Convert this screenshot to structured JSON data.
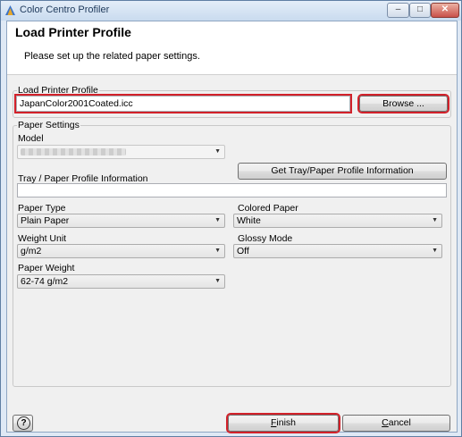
{
  "window": {
    "title": "Color Centro Profiler",
    "minimize_glyph": "–",
    "maximize_glyph": "□",
    "close_glyph": "✕"
  },
  "header": {
    "title": "Load Printer Profile",
    "subtitle": "Please set up the related paper settings."
  },
  "load_printer_profile": {
    "group_label": "Load Printer Profile",
    "file_value": "JapanColor2001Coated.icc",
    "browse_label": "Browse ..."
  },
  "paper_settings": {
    "group_label": "Paper Settings",
    "model_label": "Model",
    "model_value": "",
    "get_info_button": "Get Tray/Paper Profile Information",
    "tray_info_label": "Tray / Paper Profile Information",
    "tray_info_value": "",
    "paper_type_label": "Paper Type",
    "paper_type_value": "Plain Paper",
    "colored_paper_label": "Colored Paper",
    "colored_paper_value": "White",
    "weight_unit_label": "Weight Unit",
    "weight_unit_value": "g/m2",
    "glossy_mode_label": "Glossy Mode",
    "glossy_mode_value": "Off",
    "paper_weight_label": "Paper Weight",
    "paper_weight_value": "62-74 g/m2"
  },
  "footer": {
    "help_glyph": "?",
    "finish_mnemonic": "F",
    "finish_rest": "inish",
    "cancel_mnemonic": "C",
    "cancel_rest": "ancel"
  },
  "colors": {
    "highlight": "#d2212a",
    "titlebar": "#c9dbef"
  },
  "icons": {
    "app": "color-centro-icon",
    "dropdown": "chevron-down-icon",
    "help": "help-icon"
  }
}
